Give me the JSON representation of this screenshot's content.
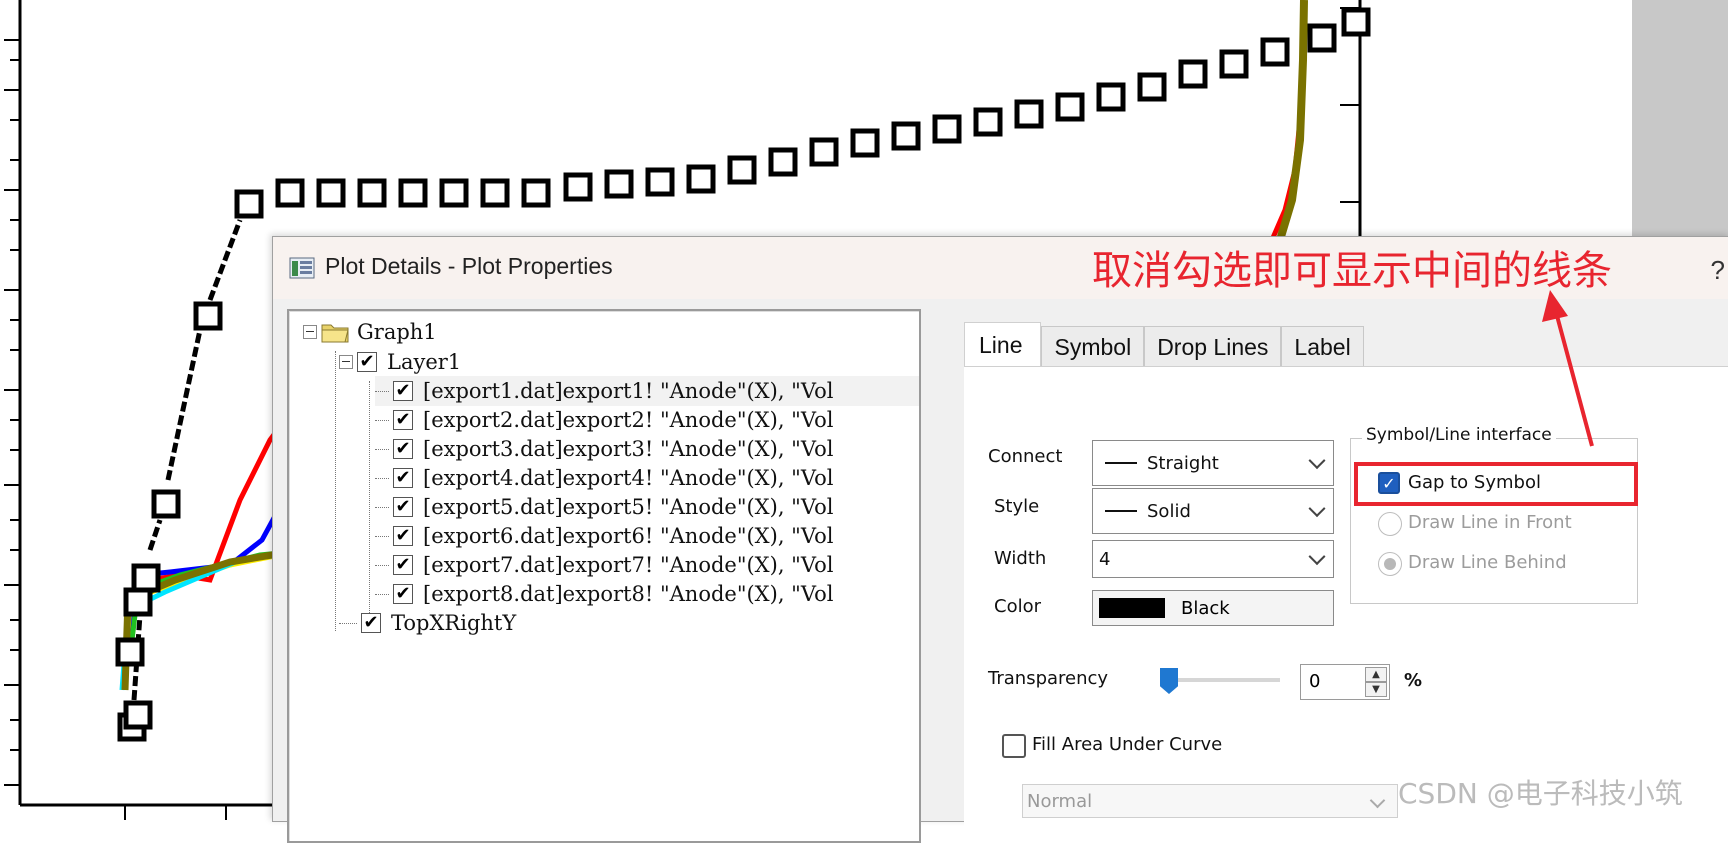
{
  "dialog": {
    "title": "Plot Details - Plot Properties",
    "help_glyph": "?"
  },
  "tree": {
    "graph": "Graph1",
    "layer": "Layer1",
    "items": [
      "[export1.dat]export1! \"Anode\"(X), \"Vol",
      "[export2.dat]export2! \"Anode\"(X), \"Vol",
      "[export3.dat]export3! \"Anode\"(X), \"Vol",
      "[export4.dat]export4! \"Anode\"(X), \"Vol",
      "[export5.dat]export5! \"Anode\"(X), \"Vol",
      "[export6.dat]export6! \"Anode\"(X), \"Vol",
      "[export7.dat]export7! \"Anode\"(X), \"Vol",
      "[export8.dat]export8! \"Anode\"(X), \"Vol"
    ],
    "extra_layer": "TopXRightY",
    "check_glyph": "✔"
  },
  "tabs": {
    "line": "Line",
    "symbol": "Symbol",
    "drop_lines": "Drop Lines",
    "label": "Label"
  },
  "line_tab": {
    "connect_label": "Connect",
    "connect_value": "Straight",
    "style_label": "Style",
    "style_value": "Solid",
    "width_label": "Width",
    "width_value": "4",
    "color_label": "Color",
    "color_value": "Black",
    "transparency_label": "Transparency",
    "transparency_value": "0",
    "transparency_unit": "%",
    "fill_label": "Fill Area Under Curve",
    "fill_mode": "Normal"
  },
  "interface": {
    "group_title": "Symbol/Line interface",
    "gap_to_symbol": "Gap to Symbol",
    "gap_checked": true,
    "draw_front": "Draw Line in Front",
    "draw_behind": "Draw Line Behind"
  },
  "annotation": {
    "text": "取消勾选即可显示中间的线条",
    "color": "#e8252f"
  },
  "watermark": "CSDN @电子科技小筑",
  "colors": {
    "accent": "#1f5fbf",
    "annotation_red": "#e8252f",
    "series_olive": "#7a7200"
  }
}
